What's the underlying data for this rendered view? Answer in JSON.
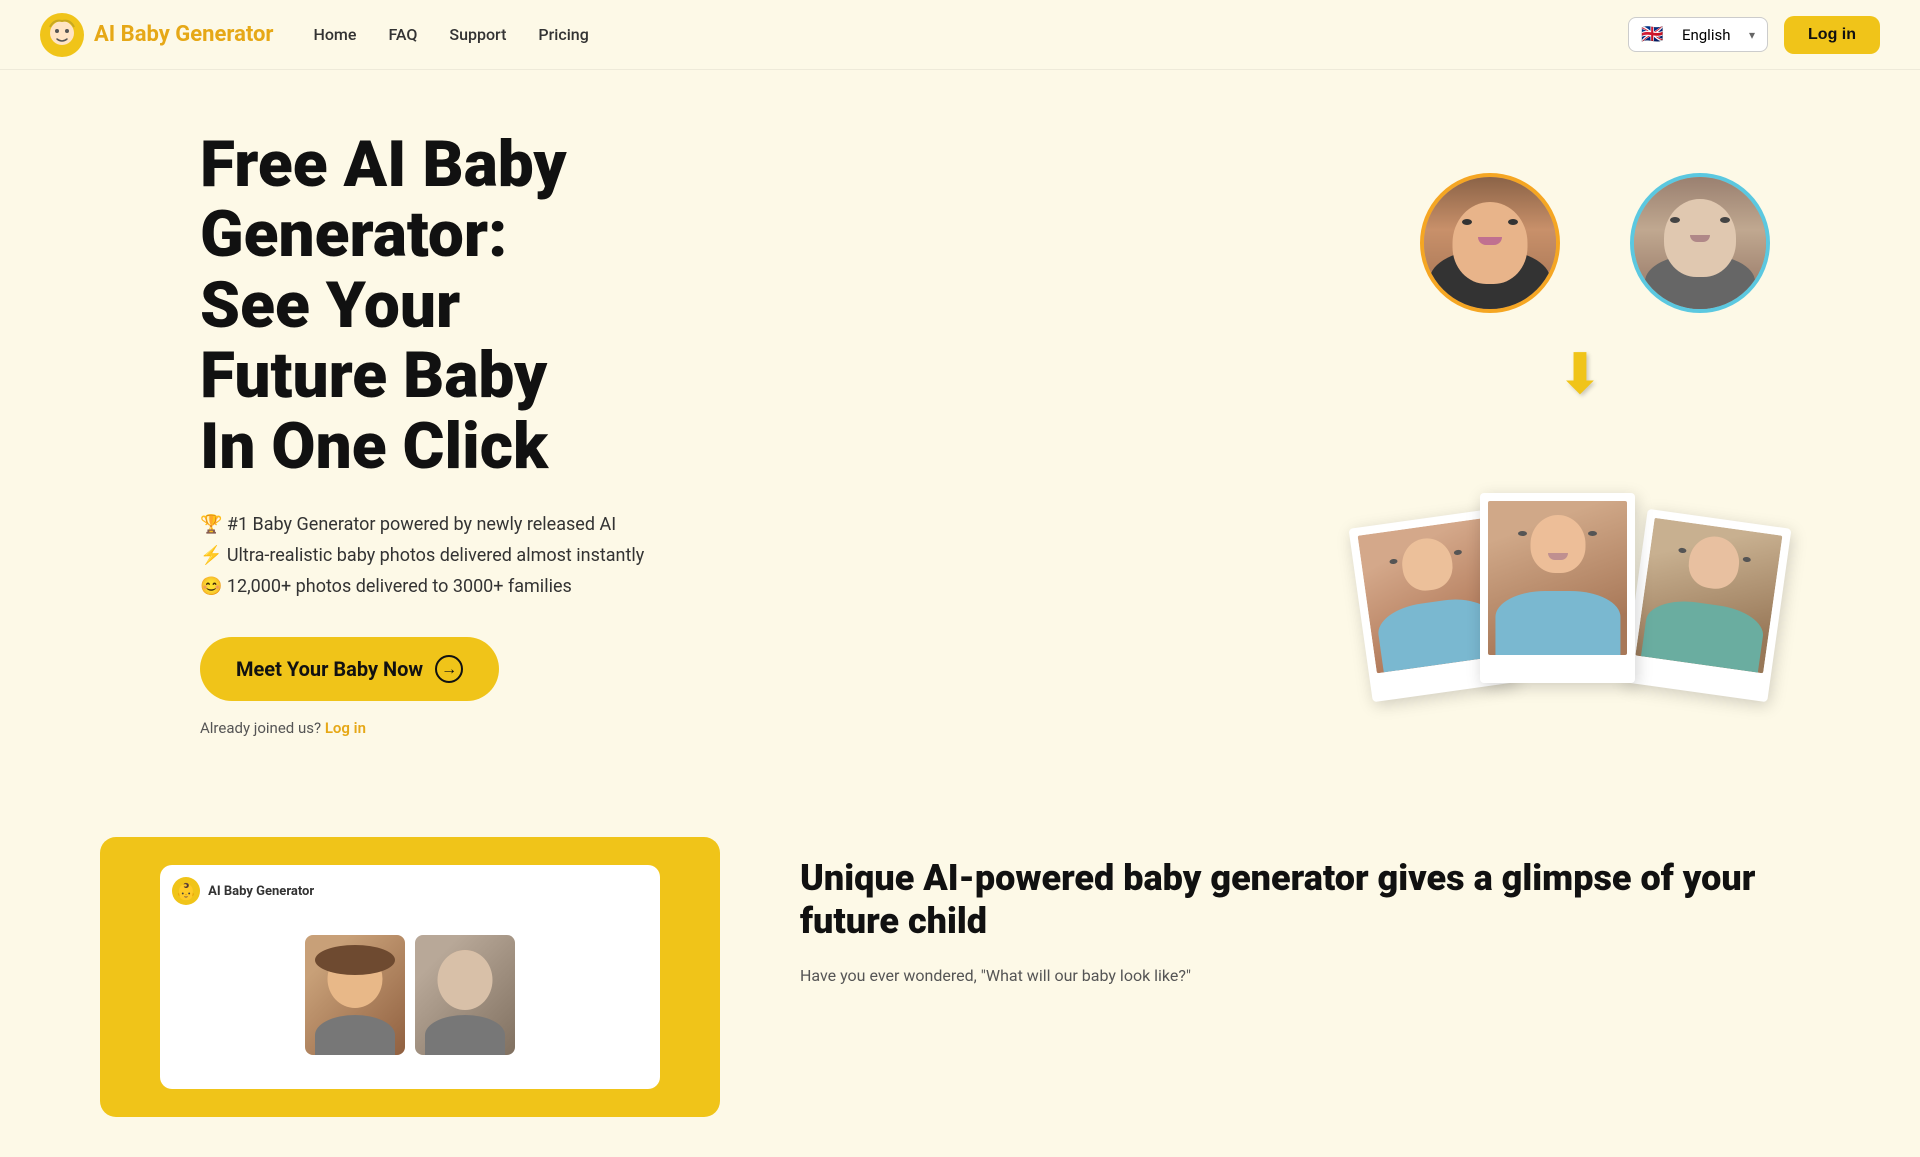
{
  "navbar": {
    "logo_text": "AI Baby Generator",
    "nav_items": [
      {
        "label": "Home",
        "href": "#"
      },
      {
        "label": "FAQ",
        "href": "#"
      },
      {
        "label": "Support",
        "href": "#"
      },
      {
        "label": "Pricing",
        "href": "#"
      }
    ],
    "lang_label": "English",
    "lang_flag": "🇬🇧",
    "login_label": "Log in"
  },
  "hero": {
    "title_line1": "Free AI Baby",
    "title_line2": "Generator:",
    "title_line3": "See Your",
    "title_line4": "Future Baby",
    "title_line5": "In One Click",
    "feature1": "🏆 #1 Baby Generator powered by newly released AI",
    "feature2": "⚡ Ultra-realistic baby photos delivered almost instantly",
    "feature3": "😊 12,000+ photos delivered to 3000+ families",
    "cta_label": "Meet Your Baby Now",
    "cta_icon": "→",
    "login_hint_text": "Already joined us?",
    "login_hint_link": "Log in"
  },
  "bottom": {
    "title": "Unique AI-powered baby generator gives a glimpse of your future child",
    "description": "Have you ever wondered, \"What will our baby look like?\"",
    "app_name": "AI Baby Generator"
  },
  "icons": {
    "logo_emoji": "👶",
    "arrow_down": "⬇"
  }
}
